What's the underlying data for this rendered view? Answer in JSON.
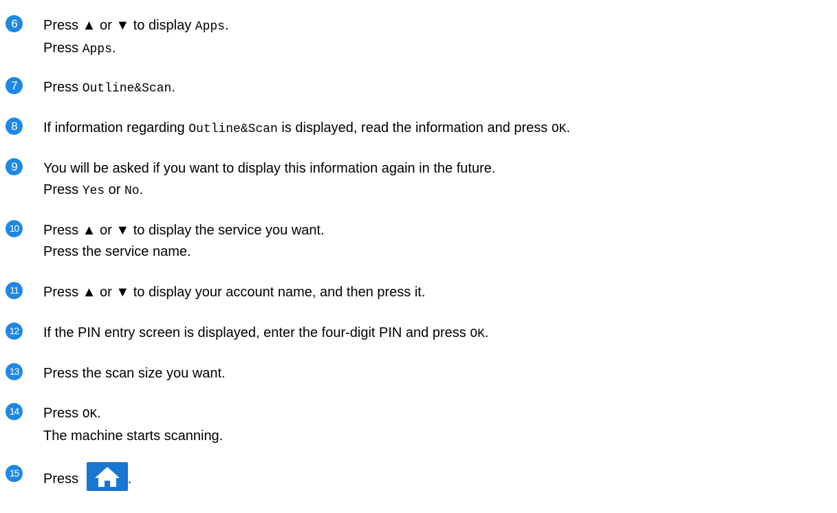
{
  "colors": {
    "step_badge": "#1e88e5",
    "home_button": "#1976d2"
  },
  "steps": [
    {
      "number": "6",
      "lines": [
        {
          "a": "Press ▲ or ▼ to display ",
          "code": "Apps",
          "b": "."
        },
        {
          "a": "Press ",
          "code": "Apps",
          "b": "."
        }
      ]
    },
    {
      "number": "7",
      "lines": [
        {
          "a": "Press ",
          "code": "Outline&Scan",
          "b": "."
        }
      ]
    },
    {
      "number": "8",
      "lines": [
        {
          "a": "If information regarding ",
          "code": "Outline&Scan",
          "b": " is displayed, read the information and press ",
          "code2": "OK",
          "c": "."
        }
      ]
    },
    {
      "number": "9",
      "lines": [
        {
          "a": "You will be asked if you want to display this information again in the future."
        },
        {
          "a": "Press ",
          "code": "Yes",
          "b": " or ",
          "code2": "No",
          "c": "."
        }
      ]
    },
    {
      "number": "10",
      "lines": [
        {
          "a": "Press ▲ or ▼ to display the service you want."
        },
        {
          "a": "Press the service name."
        }
      ]
    },
    {
      "number": "11",
      "lines": [
        {
          "a": "Press ▲ or ▼ to display your account name, and then press it."
        }
      ]
    },
    {
      "number": "12",
      "lines": [
        {
          "a": "If the PIN entry screen is displayed, enter the four-digit PIN and press ",
          "code": "OK",
          "b": "."
        }
      ]
    },
    {
      "number": "13",
      "lines": [
        {
          "a": "Press the scan size you want."
        }
      ]
    },
    {
      "number": "14",
      "lines": [
        {
          "a": "Press ",
          "code": "OK",
          "b": "."
        },
        {
          "a": "The machine starts scanning."
        }
      ]
    },
    {
      "number": "15",
      "lines": [
        {
          "a": "Press ",
          "b": "."
        }
      ],
      "icon": "home-icon"
    }
  ]
}
